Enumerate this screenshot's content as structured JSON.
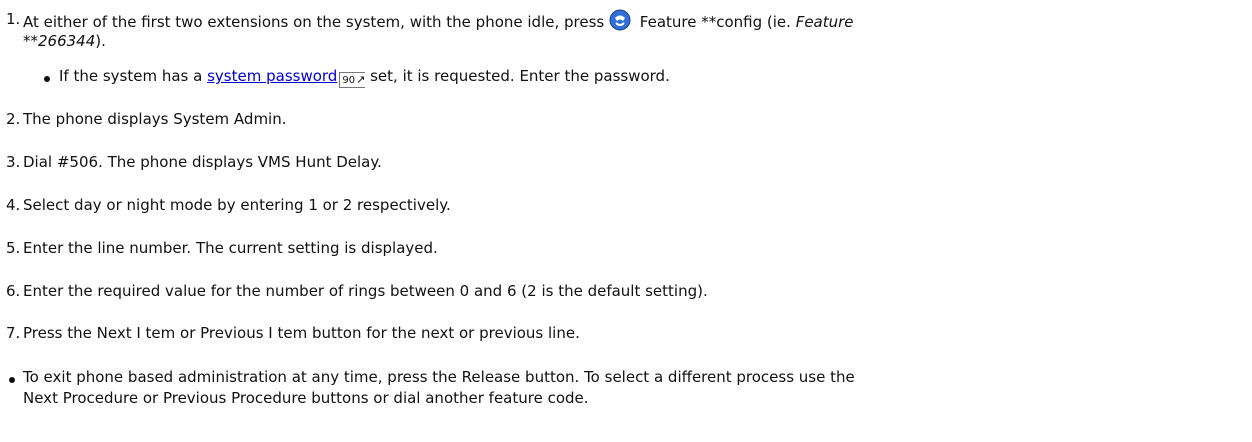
{
  "steps": [
    {
      "number": "1.",
      "pre_icon": "At either of the first two extensions on the system, with the phone idle, press",
      "icon": "feature-button-icon",
      "post_icon": "Feature **config (ie.",
      "italic": "Feature",
      "italic_cont": "**266344",
      "tail": ")."
    },
    {
      "number": "2.",
      "text": "The phone displays System Admin."
    },
    {
      "number": "3.",
      "text": "Dial #506. The phone displays VMS Hunt Delay."
    },
    {
      "number": "4.",
      "text": "Select day or night mode by entering 1 or 2 respectively."
    },
    {
      "number": "5.",
      "text": "Enter the line number. The current setting is displayed."
    },
    {
      "number": "6.",
      "text": "Enter the required value for the number of rings between 0 and 6 (2 is the default setting)."
    },
    {
      "number": "7.",
      "text": "Press the Next I tem or Previous I tem button for the next or previous line."
    }
  ],
  "sub_bullet": {
    "pre": "If the system has a",
    "link": "system password",
    "page_ref": "90",
    "post": "set, it is requested. Enter the password."
  },
  "final_bullet": {
    "line1": "To exit phone based administration at any time, press the Release button. To select a different process use the",
    "line2": "Next Procedure or Previous Procedure buttons or dial another feature code."
  },
  "colors": {
    "link": "#0000cc",
    "text": "#111111",
    "icon_blue": "#2f6fd6"
  }
}
